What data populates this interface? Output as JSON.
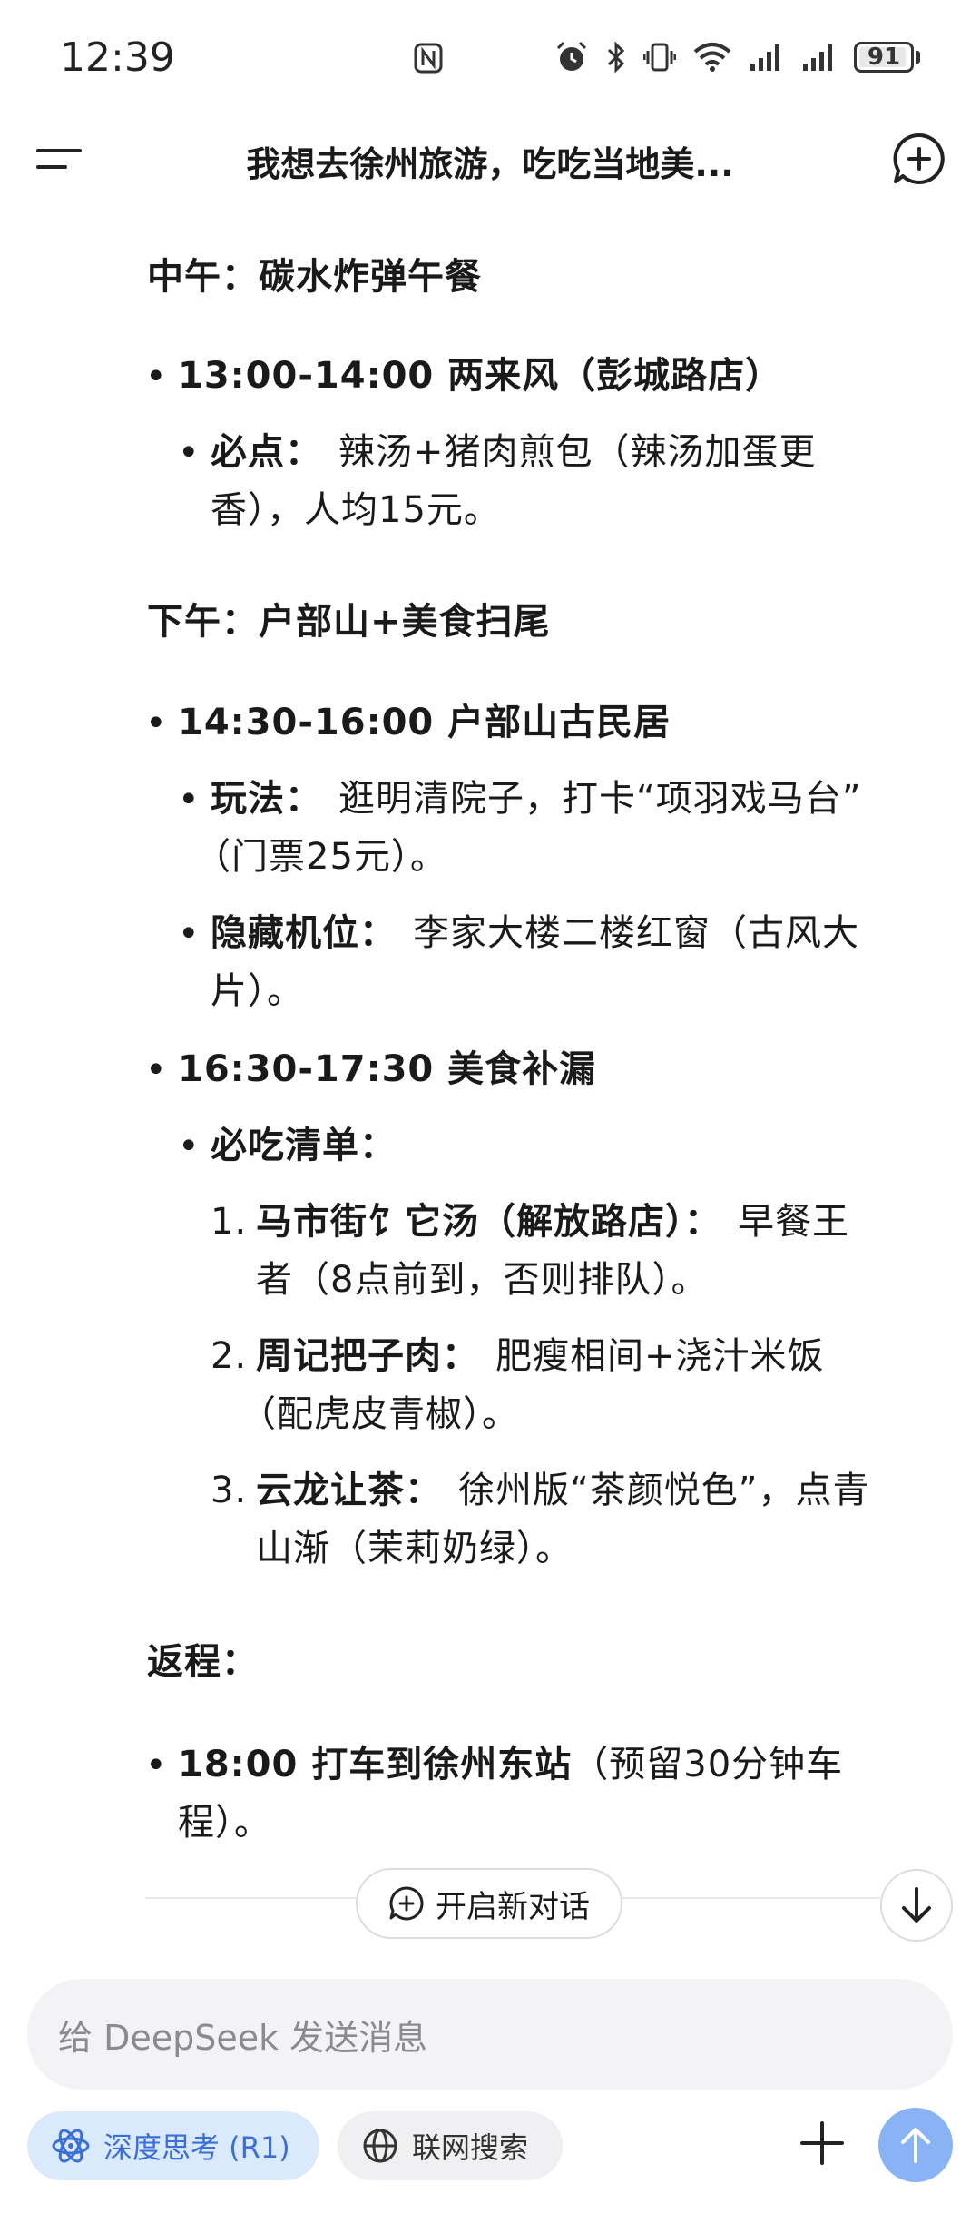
{
  "status_bar": {
    "time": "12:39",
    "battery": "91",
    "icons": [
      "nfc-icon",
      "alarm-icon",
      "bluetooth-icon",
      "vibrate-icon",
      "wifi-icon",
      "signal-icon",
      "signal-icon",
      "battery-icon"
    ]
  },
  "header": {
    "title": "我想去徐州旅游，吃吃当地美...",
    "menu_icon": "menu-icon",
    "new_chat_icon": "new-chat-icon"
  },
  "content": {
    "noon": {
      "title": "中午：碳水炸弹午餐",
      "item1": {
        "heading": "13:00-14:00 两来风（彭城路店）",
        "sub_label": "必点：",
        "sub_text_1": "辣汤+猪肉煎包（辣汤加蛋更",
        "sub_text_2": "香），人均15元。"
      }
    },
    "afternoon": {
      "title": "下午：户部山+美食扫尾",
      "item1": {
        "heading": "14:30-16:00 户部山古民居",
        "play_label": "玩法：",
        "play_text_1": "逛明清院子，打卡“项羽戏马台”",
        "play_text_2": "（门票25元）。",
        "spot_label": "隐藏机位：",
        "spot_text_1": "李家大楼二楼红窗（古风大",
        "spot_text_2": "片）。"
      },
      "item2": {
        "heading": "16:30-17:30 美食补漏",
        "list_label": "必吃清单：",
        "list": [
          {
            "num": "1.",
            "bold": "马市街饣它汤（解放路店）：",
            "text_1": "早餐王",
            "text_2": "者（8点前到，否则排队）。"
          },
          {
            "num": "2.",
            "bold": "周记把子肉：",
            "text_1": "肥瘦相间+浇汁米饭",
            "text_2": "（配虎皮青椒）。"
          },
          {
            "num": "3.",
            "bold": "云龙让茶：",
            "text_1": "徐州版“茶颜悦色”，点青",
            "text_2": "山渐（茉莉奶绿）。"
          }
        ]
      }
    },
    "return": {
      "title": "返程：",
      "item1": {
        "bold": "18:00 打车到徐州东站",
        "text_1": "（预留30分钟车",
        "text_2": "程）。"
      }
    }
  },
  "floating": {
    "new_chat_label": "开启新对话",
    "scroll_down_icon": "arrow-down-icon"
  },
  "input": {
    "placeholder": "给 DeepSeek 发送消息",
    "deep_think_label": "深度思考 (R1)",
    "web_search_label": "联网搜索",
    "colors": {
      "accent_blue": "#3a6fd8",
      "chip_bg": "#dbe9fc",
      "send_bg": "#8ab3f5"
    }
  }
}
